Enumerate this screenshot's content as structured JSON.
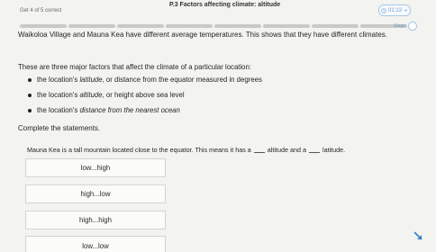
{
  "header": {
    "progress": "Get 4 of 5 correct",
    "title": "P.3 Factors affecting climate: altitude",
    "timer": "01:13",
    "stage": "Stage"
  },
  "question": {
    "intro": "Waikoloa Village and Mauna Kea have different average temperatures. This shows that they have different climates.",
    "lead": "These are three major factors that affect the climate of a particular location:",
    "factors": [
      {
        "before": "the location's ",
        "term": "latitude",
        "after": ", or distance from the equator measured in degrees"
      },
      {
        "before": "the location's ",
        "term": "altitude",
        "after": ", or height above sea level"
      },
      {
        "before": "the location's ",
        "term": "distance from the nearest ocean",
        "after": ""
      }
    ],
    "instruction": "Complete the statements.",
    "sentence_part1": "Mauna Kea is a tall mountain located close to the equator. This means it has a",
    "sentence_part2": "altitude and a",
    "sentence_part3": "latitude."
  },
  "options": [
    {
      "label": "low...high"
    },
    {
      "label": "high...low"
    },
    {
      "label": "high...high"
    },
    {
      "label": "low...low"
    }
  ],
  "colors": {
    "accent": "#6a9ed4",
    "background": "#f3f3ef"
  }
}
